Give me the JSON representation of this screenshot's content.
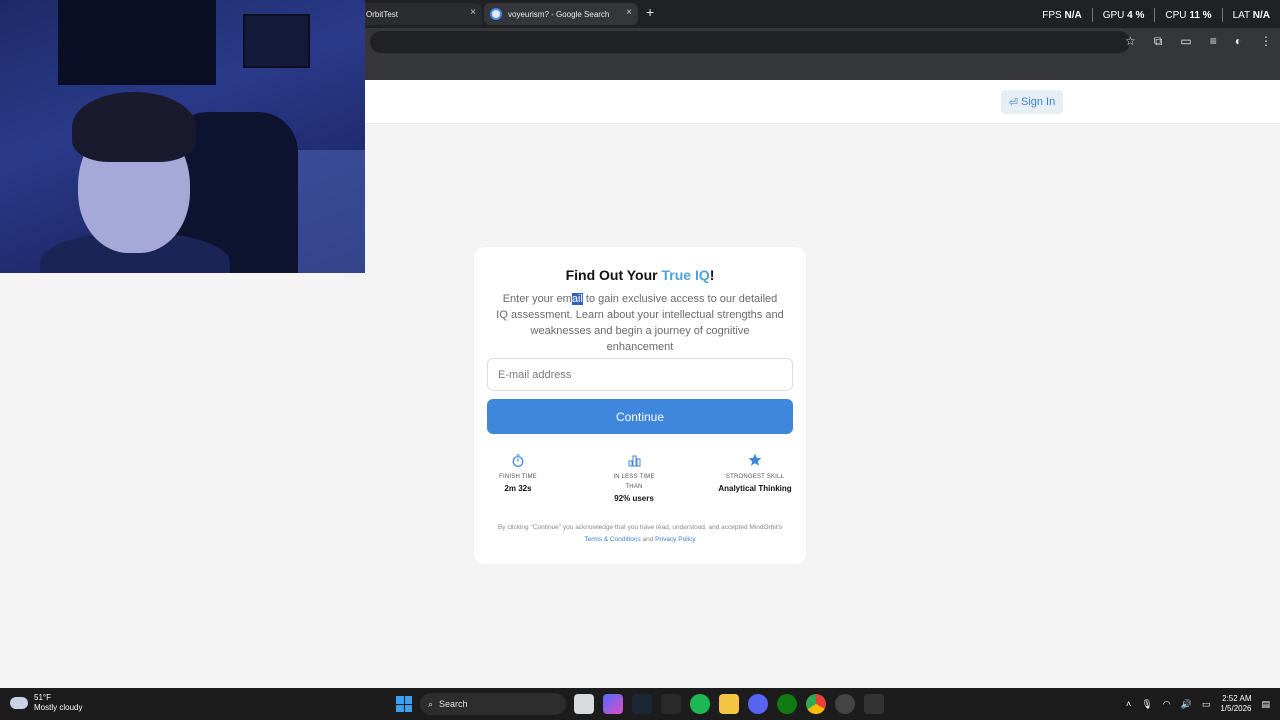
{
  "browser": {
    "tabs": [
      {
        "title": "OrbitTest",
        "active": false
      },
      {
        "title": "voyeurism? - Google Search",
        "active": true
      }
    ],
    "new_tab": "+",
    "close_glyph": "×"
  },
  "overlay": {
    "fps_label": "FPS",
    "fps_value": "N/A",
    "gpu_label": "GPU",
    "gpu_value": "4 %",
    "cpu_label": "CPU",
    "cpu_value": "11 %",
    "lat_label": "LAT",
    "lat_value": "N/A"
  },
  "header": {
    "signin_label": "Sign In"
  },
  "card": {
    "title_prefix": "Find Out Your ",
    "title_accent": "True IQ",
    "title_suffix": "!",
    "desc_before": "Enter your em",
    "desc_selected": "ail",
    "desc_after": " to gain exclusive access to our detailed IQ assessment. Learn about your intellectual strengths and weaknesses and begin a journey of cognitive enhancement",
    "email_placeholder": "E-mail address",
    "continue_label": "Continue",
    "stats": [
      {
        "label": "FINISH TIME",
        "value": "2m 32s",
        "icon": "stopwatch-icon"
      },
      {
        "label": "IN LESS TIME THAN",
        "value": "92% users",
        "icon": "bar-chart-icon"
      },
      {
        "label": "STRONGEST SKILL",
        "value": "Analytical Thinking",
        "icon": "star-icon"
      }
    ],
    "legal_text_1": "By clicking \"Continue\" you acknowledge that you have read, understood, and accepted MindOrbit's ",
    "terms_label": "Terms & Conditions",
    "legal_and": " and ",
    "privacy_label": "Privacy Policy"
  },
  "taskbar": {
    "weather_temp": "51°F",
    "weather_desc": "Mostly cloudy",
    "search_label": "Search",
    "time": "2:52 AM",
    "date": "1/5/2026"
  },
  "colors": {
    "accent": "#3f86dd",
    "title_accent": "#4fa3d6"
  }
}
